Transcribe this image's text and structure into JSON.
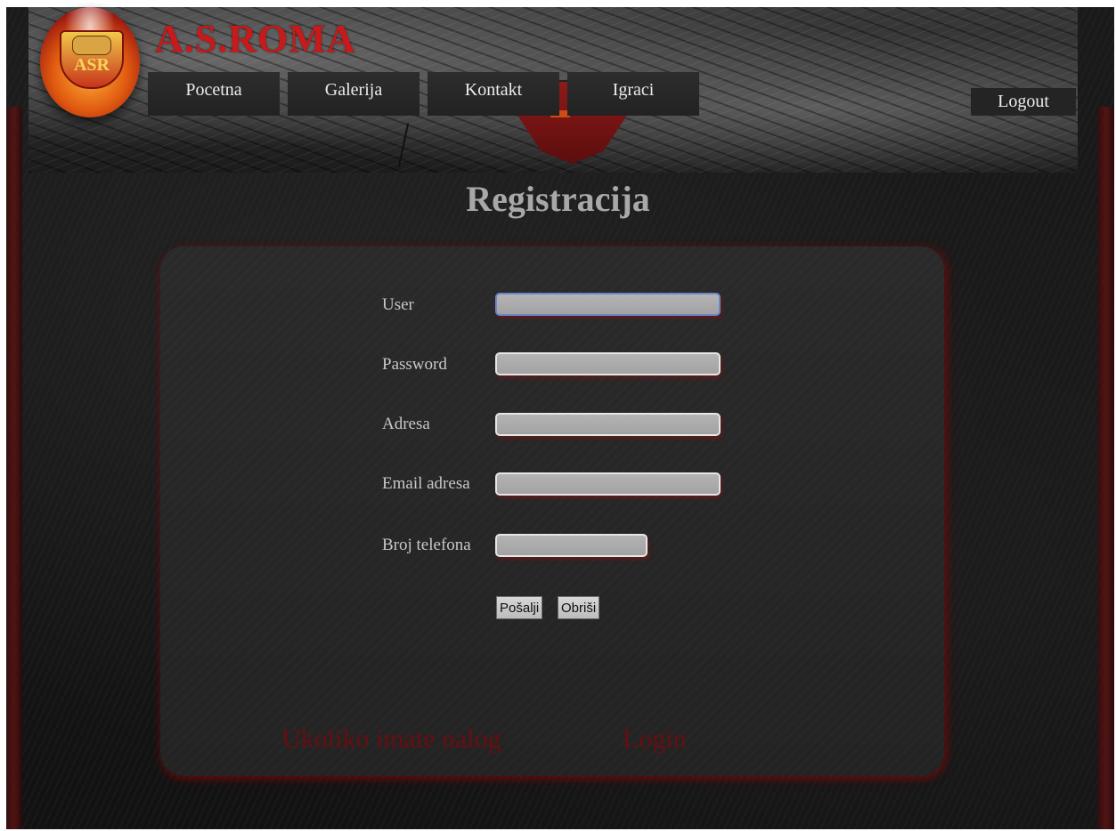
{
  "header": {
    "brand": "A.S.ROMA",
    "logo_monogram": "ASR",
    "nav": [
      {
        "label": "Pocetna"
      },
      {
        "label": "Galerija"
      },
      {
        "label": "Kontakt"
      },
      {
        "label": "Igraci"
      }
    ],
    "logout": "Logout"
  },
  "main": {
    "title": "Registracija",
    "form": {
      "fields": [
        {
          "label": "User",
          "value": ""
        },
        {
          "label": "Password",
          "value": ""
        },
        {
          "label": "Adresa",
          "value": ""
        },
        {
          "label": "Email adresa",
          "value": ""
        },
        {
          "label": "Broj telefona",
          "value": ""
        }
      ],
      "submit": "Pošalji",
      "reset": "Obriši"
    },
    "footer": {
      "prompt": "Ukoliko imate nalog",
      "login": "Login"
    }
  },
  "colors": {
    "brand_red": "#c8191b",
    "dark_red": "#6a0d10",
    "background": "#1a1a1a",
    "panel": "#262626",
    "focus_border": "#6c86c9"
  }
}
